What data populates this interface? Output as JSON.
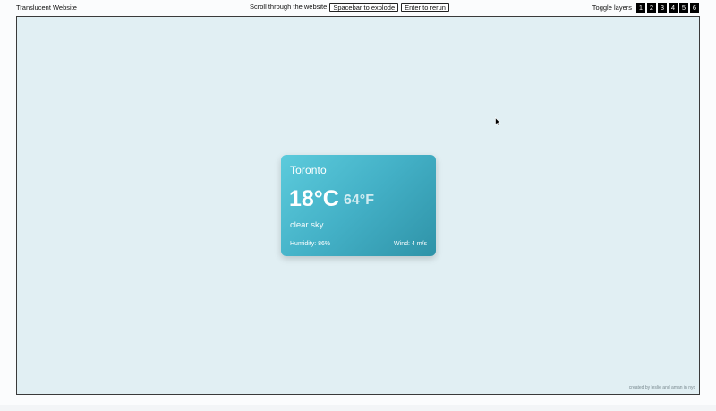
{
  "header": {
    "site_title": "Translucent Website",
    "scroll_hint": "Scroll through the website",
    "explode_button": "Spacebar to explode",
    "rerun_button": "Enter to rerun",
    "layers_label": "Toggle layers",
    "layers": [
      "1",
      "2",
      "3",
      "4",
      "5",
      "6"
    ]
  },
  "weather_card": {
    "city": "Toronto",
    "temp_c": "18°C",
    "temp_f": "64°F",
    "description": "clear sky",
    "humidity": "Humidity: 86%",
    "wind": "Wind: 4 m/s"
  },
  "footer": {
    "credit": "created by leslie and aman in nyc"
  },
  "colors": {
    "stage_bg": "#e1eff3",
    "card_gradient_start": "#5ccbdc",
    "card_gradient_end": "#2f93a8",
    "layer_button_bg": "#000000"
  },
  "icons": {
    "cursor": "mouse-pointer-icon"
  }
}
